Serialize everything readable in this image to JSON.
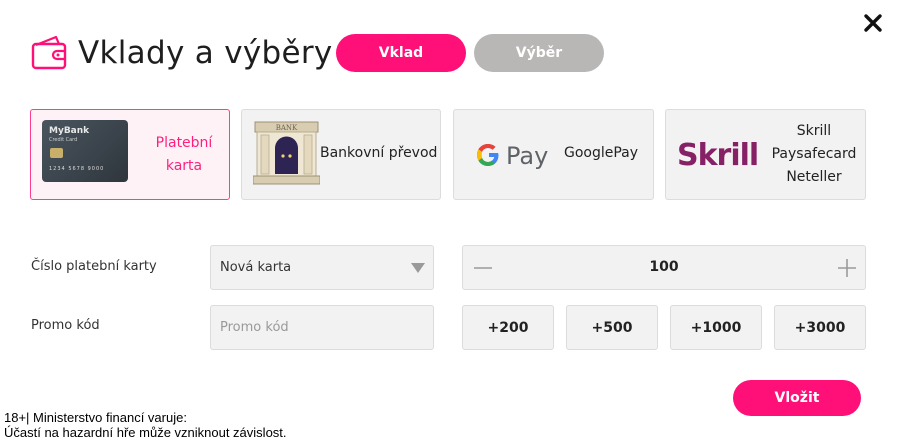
{
  "header": {
    "title": "Vklady a výběry",
    "icon": "wallet-icon"
  },
  "tabs": [
    {
      "label": "Vklad",
      "active": true
    },
    {
      "label": "Výběr",
      "active": false
    }
  ],
  "methods": {
    "card": {
      "label_line1": "Platební",
      "label_line2": "karta",
      "card_brand": "MyBank",
      "card_sub": "Credit Card",
      "card_number": "1234 5678 9000",
      "selected": true
    },
    "bank": {
      "label": "Bankovní převod",
      "sign": "BANK"
    },
    "googlepay": {
      "label": "GooglePay",
      "logo_text": "Pay"
    },
    "skrill": {
      "logo_text": "Skrill",
      "labels": [
        "Skrill",
        "Paysafecard",
        "Neteller"
      ]
    }
  },
  "form": {
    "card_label": "Číslo platební karty",
    "card_value": "Nová karta",
    "promo_label": "Promo kód",
    "promo_placeholder": "Promo kód",
    "amount": "100",
    "quick_amounts": [
      "+200",
      "+500",
      "+1000",
      "+3000"
    ],
    "submit": "Vložit"
  },
  "warning": {
    "line1": "18+| Ministerstvo financí varuje:",
    "line2": "Účastí na hazardní hře může vzniknout závislost."
  },
  "colors": {
    "accent": "#ff0f78",
    "tab_inactive": "#b9b6b6",
    "skrill": "#862165"
  }
}
